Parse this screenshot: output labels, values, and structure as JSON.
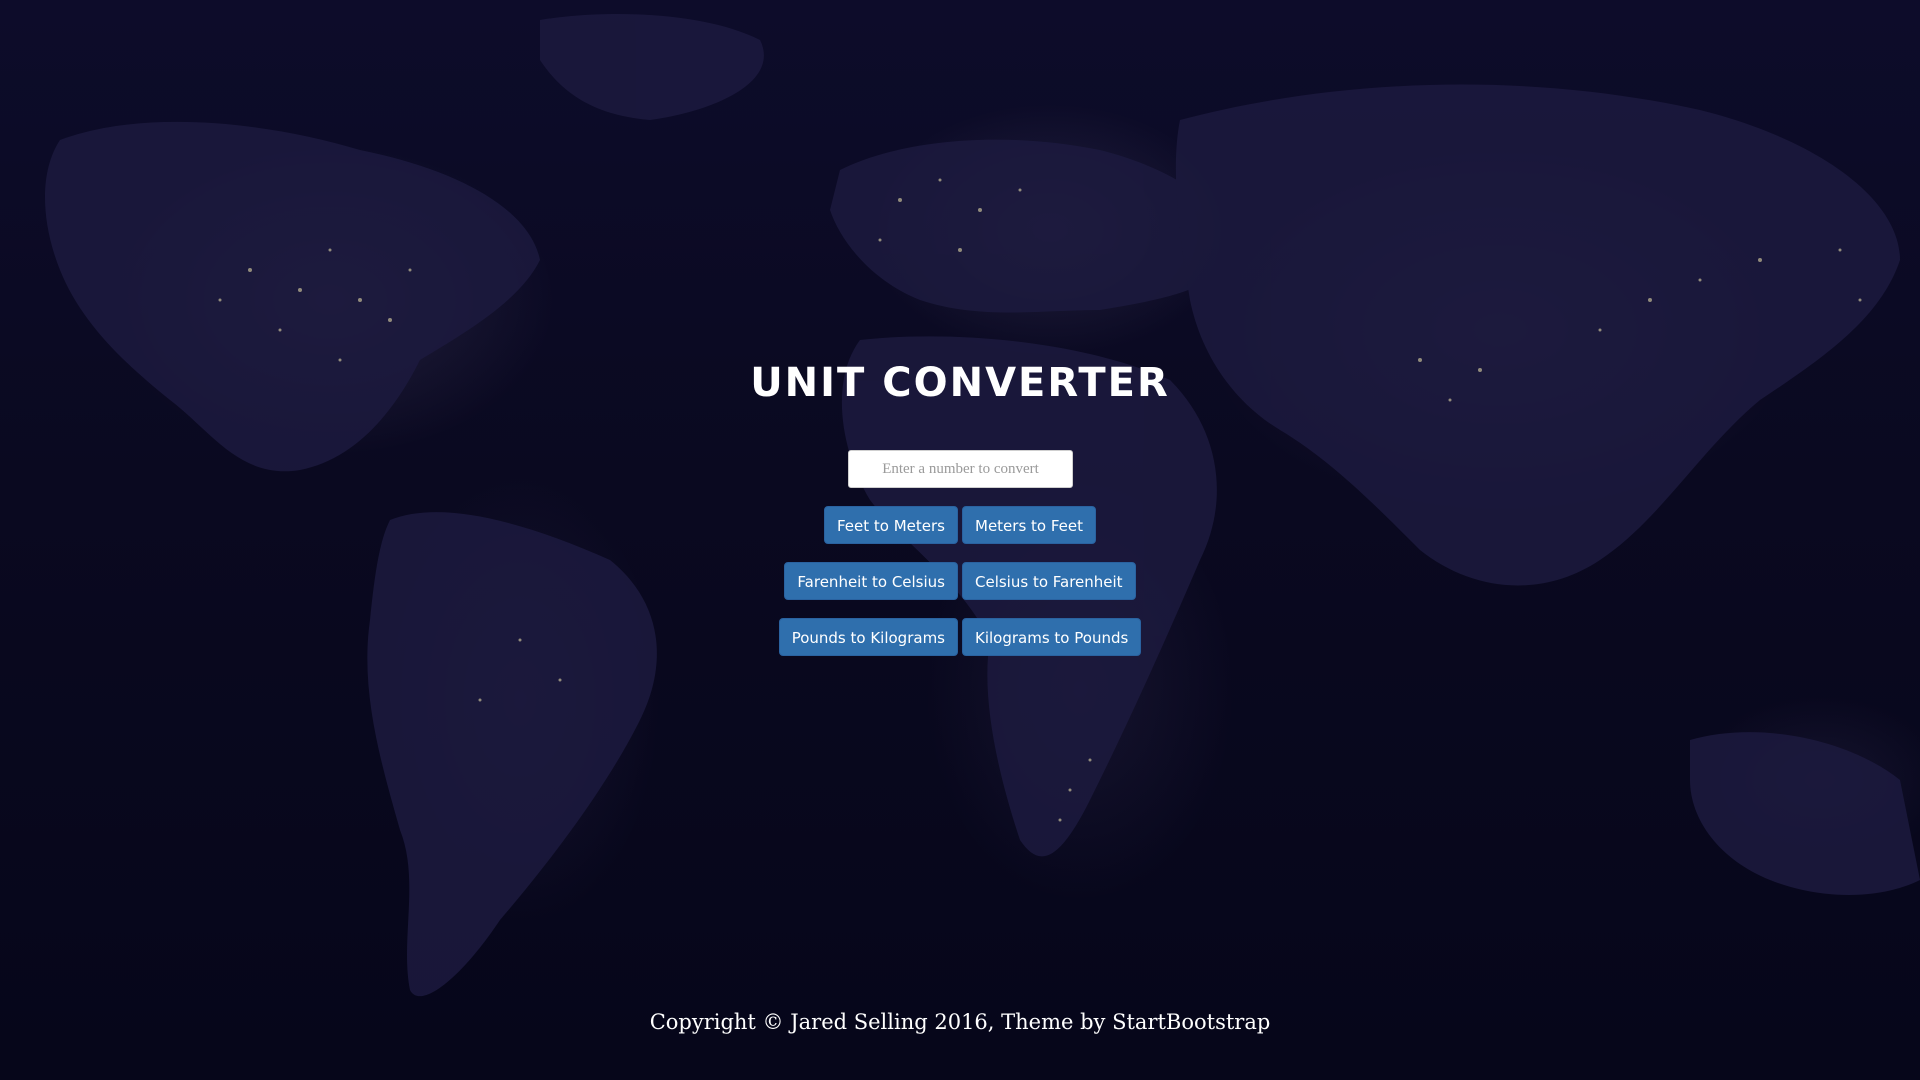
{
  "page": {
    "title": "UNIT CONVERTER"
  },
  "converter": {
    "input_placeholder": "Enter a number to convert",
    "input_value": "",
    "buttons": [
      {
        "label": "Feet to Meters"
      },
      {
        "label": "Meters to Feet"
      },
      {
        "label": "Farenheit to Celsius"
      },
      {
        "label": "Celsius to Farenheit"
      },
      {
        "label": "Pounds to Kilograms"
      },
      {
        "label": "Kilograms to Pounds"
      }
    ]
  },
  "footer": {
    "prefix": "Copyright © Jared Selling 2016, Theme by ",
    "link_text": "StartBootstrap"
  },
  "colors": {
    "background": "#0a0920",
    "button": "#2f6fad",
    "text": "#ffffff",
    "city_lights": "#f3e9b0"
  }
}
